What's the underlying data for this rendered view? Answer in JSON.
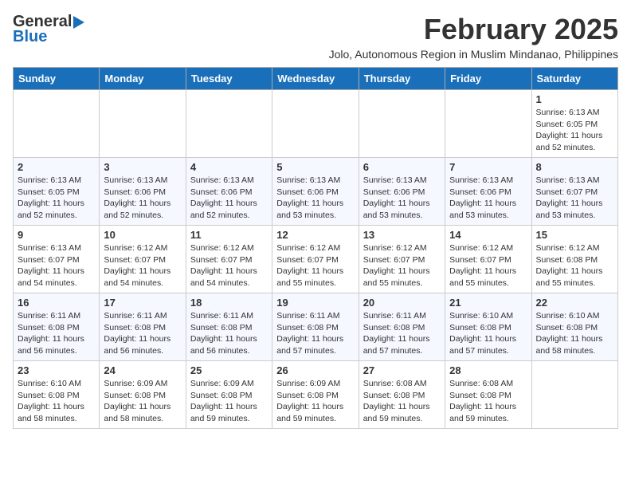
{
  "header": {
    "logo_line1": "General",
    "logo_line2": "Blue",
    "month_year": "February 2025",
    "subtitle": "Jolo, Autonomous Region in Muslim Mindanao, Philippines"
  },
  "days_of_week": [
    "Sunday",
    "Monday",
    "Tuesday",
    "Wednesday",
    "Thursday",
    "Friday",
    "Saturday"
  ],
  "weeks": [
    [
      {
        "day": "",
        "info": ""
      },
      {
        "day": "",
        "info": ""
      },
      {
        "day": "",
        "info": ""
      },
      {
        "day": "",
        "info": ""
      },
      {
        "day": "",
        "info": ""
      },
      {
        "day": "",
        "info": ""
      },
      {
        "day": "1",
        "info": "Sunrise: 6:13 AM\nSunset: 6:05 PM\nDaylight: 11 hours and 52 minutes."
      }
    ],
    [
      {
        "day": "2",
        "info": "Sunrise: 6:13 AM\nSunset: 6:05 PM\nDaylight: 11 hours and 52 minutes."
      },
      {
        "day": "3",
        "info": "Sunrise: 6:13 AM\nSunset: 6:06 PM\nDaylight: 11 hours and 52 minutes."
      },
      {
        "day": "4",
        "info": "Sunrise: 6:13 AM\nSunset: 6:06 PM\nDaylight: 11 hours and 52 minutes."
      },
      {
        "day": "5",
        "info": "Sunrise: 6:13 AM\nSunset: 6:06 PM\nDaylight: 11 hours and 53 minutes."
      },
      {
        "day": "6",
        "info": "Sunrise: 6:13 AM\nSunset: 6:06 PM\nDaylight: 11 hours and 53 minutes."
      },
      {
        "day": "7",
        "info": "Sunrise: 6:13 AM\nSunset: 6:06 PM\nDaylight: 11 hours and 53 minutes."
      },
      {
        "day": "8",
        "info": "Sunrise: 6:13 AM\nSunset: 6:07 PM\nDaylight: 11 hours and 53 minutes."
      }
    ],
    [
      {
        "day": "9",
        "info": "Sunrise: 6:13 AM\nSunset: 6:07 PM\nDaylight: 11 hours and 54 minutes."
      },
      {
        "day": "10",
        "info": "Sunrise: 6:12 AM\nSunset: 6:07 PM\nDaylight: 11 hours and 54 minutes."
      },
      {
        "day": "11",
        "info": "Sunrise: 6:12 AM\nSunset: 6:07 PM\nDaylight: 11 hours and 54 minutes."
      },
      {
        "day": "12",
        "info": "Sunrise: 6:12 AM\nSunset: 6:07 PM\nDaylight: 11 hours and 55 minutes."
      },
      {
        "day": "13",
        "info": "Sunrise: 6:12 AM\nSunset: 6:07 PM\nDaylight: 11 hours and 55 minutes."
      },
      {
        "day": "14",
        "info": "Sunrise: 6:12 AM\nSunset: 6:07 PM\nDaylight: 11 hours and 55 minutes."
      },
      {
        "day": "15",
        "info": "Sunrise: 6:12 AM\nSunset: 6:08 PM\nDaylight: 11 hours and 55 minutes."
      }
    ],
    [
      {
        "day": "16",
        "info": "Sunrise: 6:11 AM\nSunset: 6:08 PM\nDaylight: 11 hours and 56 minutes."
      },
      {
        "day": "17",
        "info": "Sunrise: 6:11 AM\nSunset: 6:08 PM\nDaylight: 11 hours and 56 minutes."
      },
      {
        "day": "18",
        "info": "Sunrise: 6:11 AM\nSunset: 6:08 PM\nDaylight: 11 hours and 56 minutes."
      },
      {
        "day": "19",
        "info": "Sunrise: 6:11 AM\nSunset: 6:08 PM\nDaylight: 11 hours and 57 minutes."
      },
      {
        "day": "20",
        "info": "Sunrise: 6:11 AM\nSunset: 6:08 PM\nDaylight: 11 hours and 57 minutes."
      },
      {
        "day": "21",
        "info": "Sunrise: 6:10 AM\nSunset: 6:08 PM\nDaylight: 11 hours and 57 minutes."
      },
      {
        "day": "22",
        "info": "Sunrise: 6:10 AM\nSunset: 6:08 PM\nDaylight: 11 hours and 58 minutes."
      }
    ],
    [
      {
        "day": "23",
        "info": "Sunrise: 6:10 AM\nSunset: 6:08 PM\nDaylight: 11 hours and 58 minutes."
      },
      {
        "day": "24",
        "info": "Sunrise: 6:09 AM\nSunset: 6:08 PM\nDaylight: 11 hours and 58 minutes."
      },
      {
        "day": "25",
        "info": "Sunrise: 6:09 AM\nSunset: 6:08 PM\nDaylight: 11 hours and 59 minutes."
      },
      {
        "day": "26",
        "info": "Sunrise: 6:09 AM\nSunset: 6:08 PM\nDaylight: 11 hours and 59 minutes."
      },
      {
        "day": "27",
        "info": "Sunrise: 6:08 AM\nSunset: 6:08 PM\nDaylight: 11 hours and 59 minutes."
      },
      {
        "day": "28",
        "info": "Sunrise: 6:08 AM\nSunset: 6:08 PM\nDaylight: 11 hours and 59 minutes."
      },
      {
        "day": "",
        "info": ""
      }
    ]
  ]
}
